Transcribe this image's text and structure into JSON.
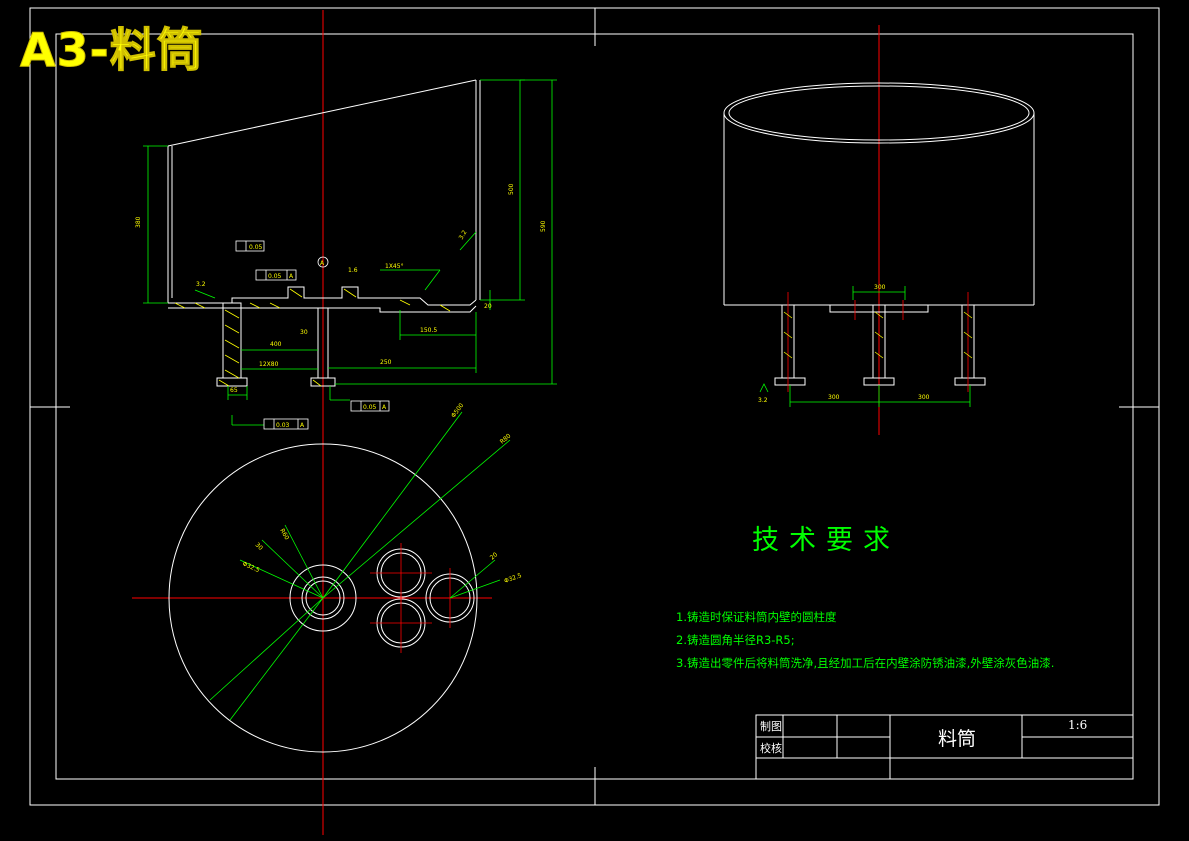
{
  "sheet": {
    "title": "A3-料筒",
    "colors": {
      "outline": "#ffffff",
      "dimension": "#00ff00",
      "centerline": "#ff0000",
      "title": "#ffff00",
      "annotation": "#ffff00"
    }
  },
  "technical_requirements": {
    "heading": "技术要求",
    "items": [
      "1.铸造时保证料筒内壁的圆柱度",
      "2.铸造圆角半径R3-R5;",
      "3.铸造出零件后将料筒洗净,且经加工后在内壁涂防锈油漆,外壁涂灰色油漆."
    ]
  },
  "title_block": {
    "drawn_label": "制图",
    "checked_label": "校核",
    "part_name": "料筒",
    "scale": "1:6"
  },
  "annotations": {
    "flatness_1": "0.05",
    "flatness_2": "0.05",
    "parallel_1": "0.03",
    "parallel_2": "0.05",
    "datum": "A",
    "roughness": "3.2",
    "roughness_2": "1.6",
    "roughness_3": "3.2",
    "dim_left_height": "380",
    "dim_right_height": "500",
    "dim_right_total": "590",
    "dim_inner": "150.5",
    "dim_bottom_left": "250",
    "dim_bottom_mid": "400",
    "dim_leg": "12X80",
    "dim_spacing_1": "300",
    "dim_spacing_2": "300",
    "dim_center": "300",
    "dim_small_1": "30",
    "dim_small_2": "20",
    "dim_small_3": "65",
    "dim_radius_1": "R80",
    "dim_radius_2": "R60",
    "dim_chamfer": "1X45°",
    "dim_hole": "Φ32.5",
    "dim_circle_d": "Φ500"
  }
}
